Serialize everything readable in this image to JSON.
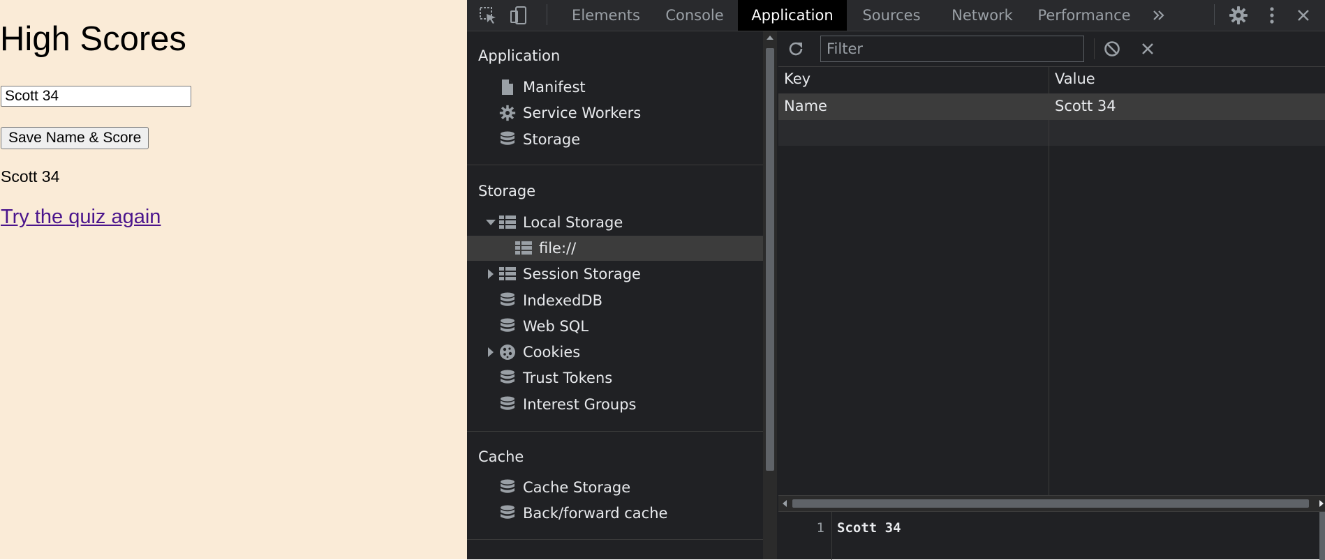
{
  "page": {
    "heading": "High Scores",
    "name_input_value": "Scott 34",
    "save_button_label": "Save Name & Score",
    "score_text": "Scott 34",
    "link_text": "Try the quiz again"
  },
  "devtools": {
    "tabs": [
      {
        "label": "Elements",
        "active": false
      },
      {
        "label": "Console",
        "active": false
      },
      {
        "label": "Application",
        "active": true
      },
      {
        "label": "Sources",
        "active": false
      },
      {
        "label": "Network",
        "active": false
      },
      {
        "label": "Performance",
        "active": false
      }
    ],
    "toolbar_icons": [
      "inspect-element-icon",
      "device-toolbar-icon",
      "more-tabs-icon",
      "settings-gear-icon",
      "more-options-icon",
      "close-icon"
    ],
    "sidebar": {
      "application": {
        "title": "Application",
        "items": [
          {
            "label": "Manifest",
            "icon": "file-icon"
          },
          {
            "label": "Service Workers",
            "icon": "gear-icon"
          },
          {
            "label": "Storage",
            "icon": "database-icon"
          }
        ]
      },
      "storage": {
        "title": "Storage",
        "items": [
          {
            "label": "Local Storage",
            "icon": "grid-icon",
            "expanded": true
          },
          {
            "label": "file://",
            "icon": "grid-icon",
            "selected": true
          },
          {
            "label": "Session Storage",
            "icon": "grid-icon",
            "expanded": false
          },
          {
            "label": "IndexedDB",
            "icon": "database-icon"
          },
          {
            "label": "Web SQL",
            "icon": "database-icon"
          },
          {
            "label": "Cookies",
            "icon": "cookie-icon",
            "expanded": false
          },
          {
            "label": "Trust Tokens",
            "icon": "database-icon"
          },
          {
            "label": "Interest Groups",
            "icon": "database-icon"
          }
        ]
      },
      "cache": {
        "title": "Cache",
        "items": [
          {
            "label": "Cache Storage",
            "icon": "database-icon"
          },
          {
            "label": "Back/forward cache",
            "icon": "database-icon"
          }
        ]
      }
    },
    "main": {
      "filter_placeholder": "Filter",
      "toolbar_icons": [
        "refresh-icon",
        "clear-all-icon",
        "delete-selected-icon"
      ],
      "columns": [
        "Key",
        "Value"
      ],
      "rows": [
        {
          "key": "Name",
          "value": "Scott 34"
        }
      ],
      "preview": {
        "line_number": "1",
        "content": "Scott 34"
      }
    },
    "colors": {
      "background": "#202124",
      "tabbar": "#292a2d",
      "selected_row": "#3c3c3c",
      "page_background": "#faebd7",
      "link": "#4a148c"
    }
  }
}
